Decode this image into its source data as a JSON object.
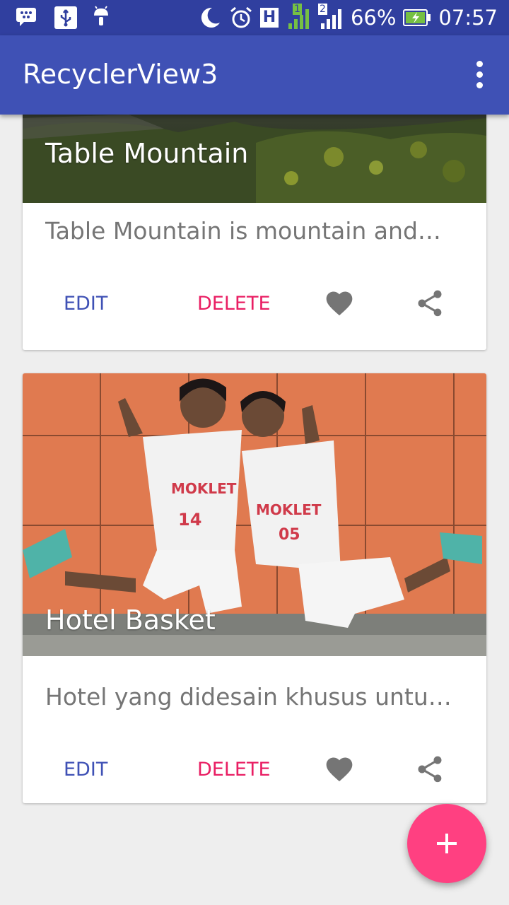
{
  "status_bar": {
    "network_type": "H",
    "sim1_label": "1",
    "sim2_label": "2",
    "battery_percent": "66%",
    "time": "07:57"
  },
  "app_bar": {
    "title": "RecyclerView3"
  },
  "cards": [
    {
      "title": "Table Mountain",
      "description": "Table Mountain is mountain and…",
      "edit_label": "EDIT",
      "delete_label": "DELETE"
    },
    {
      "title": "Hotel Basket",
      "description": "Hotel yang didesain khusus untuk…",
      "edit_label": "EDIT",
      "delete_label": "DELETE"
    }
  ],
  "colors": {
    "primary": "#3f51b5",
    "primary_dark": "#303f9f",
    "accent": "#ff4081",
    "delete_text": "#e91e63",
    "edit_text": "#3f51b5"
  },
  "icons": {
    "like": "heart-icon",
    "share": "share-icon",
    "fab": "plus-icon",
    "overflow": "more-vert-icon"
  }
}
